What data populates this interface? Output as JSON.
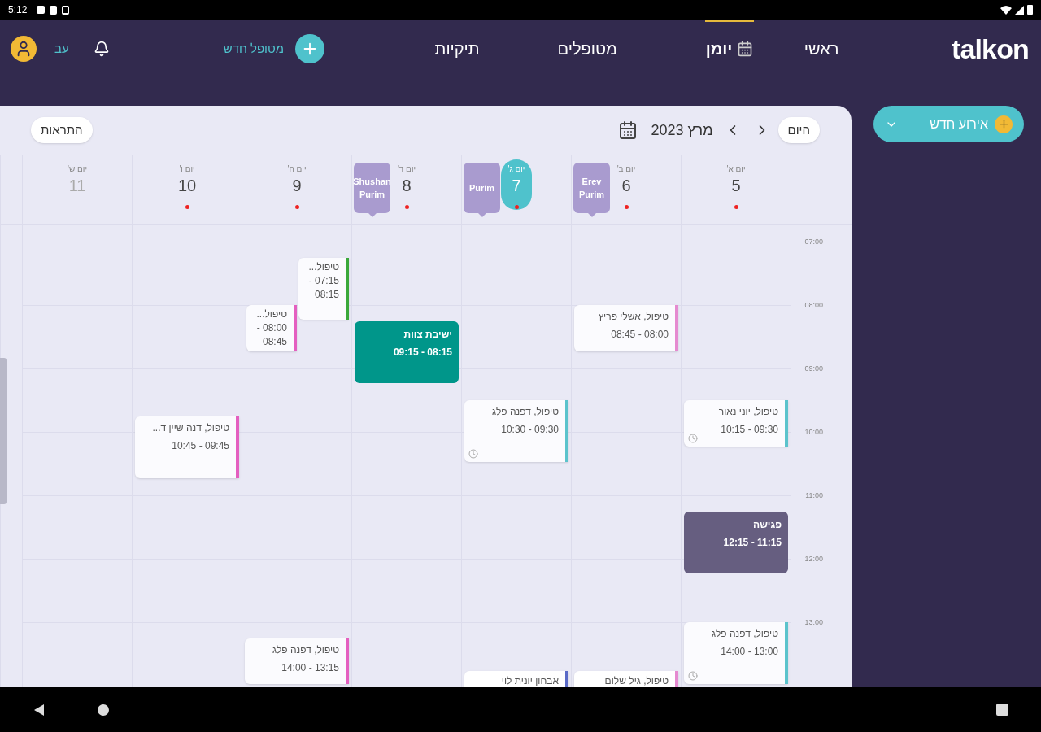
{
  "status_bar": {
    "time": "5:12"
  },
  "header": {
    "logo": "talkon",
    "user_initials": "עב",
    "new_patient": "מטופל חדש",
    "nav": [
      {
        "label": "ראשי",
        "selected": false
      },
      {
        "label": "יומן",
        "selected": true,
        "icon": true
      },
      {
        "label": "מטופלים",
        "selected": false
      },
      {
        "label": "תיקיות",
        "selected": false
      }
    ]
  },
  "new_event_button": "אירוע חדש",
  "calendar": {
    "today_button": "היום",
    "month": "מרץ 2023",
    "alerts_button": "התראות",
    "hours": [
      "07:00",
      "08:00",
      "09:00",
      "10:00",
      "11:00",
      "12:00",
      "13:00"
    ],
    "days": [
      {
        "name": "יום א'",
        "number": "5",
        "dot": true,
        "today": false,
        "muted": false,
        "events": [
          {
            "kind": "appointment",
            "title": "טיפול, יוני נאור",
            "time": "09:30 - 10:15",
            "color": "#5bc3cc",
            "clock": true
          },
          {
            "kind": "block",
            "title": "פגישה",
            "time": "11:15 - 12:15",
            "color": "#665e80"
          },
          {
            "kind": "appointment",
            "title": "טיפול, דפנה פלג",
            "time": "13:00 - 14:00",
            "color": "#5bc3cc",
            "clock": true
          }
        ]
      },
      {
        "name": "יום ב'",
        "number": "6",
        "dot": true,
        "today": false,
        "muted": false,
        "holiday": "Erev Purim",
        "events": [
          {
            "kind": "appointment",
            "title": "טיפול, אשלי פריץ",
            "time": "08:00 - 08:45",
            "color": "#e58ad0"
          },
          {
            "kind": "partial",
            "title": "טיפול, גיל שלום",
            "color": "#e58ad0"
          }
        ]
      },
      {
        "name": "יום ג'",
        "number": "7",
        "dot": true,
        "today": true,
        "muted": false,
        "holiday": "Purim",
        "events": [
          {
            "kind": "appointment",
            "title": "טיפול, דפנה פלג",
            "time": "09:30 - 10:30",
            "color": "#5bc3cc",
            "clock": true
          },
          {
            "kind": "partial",
            "title": "אבחון יונית לוי",
            "color": "#5b6bc7"
          }
        ]
      },
      {
        "name": "יום ד'",
        "number": "8",
        "dot": true,
        "today": false,
        "muted": false,
        "holiday": "Shushan Purim",
        "events": [
          {
            "kind": "block",
            "title": "ישיבת צוות",
            "time": "08:15 - 09:15",
            "color": "#00968a"
          }
        ]
      },
      {
        "name": "יום ה'",
        "number": "9",
        "dot": true,
        "today": false,
        "muted": false,
        "events": [
          {
            "kind": "appointment",
            "title": "טיפול...",
            "time": "07:15 - 08:15",
            "color": "#3aa83a"
          },
          {
            "kind": "appointment",
            "title": "טיפול...",
            "time": "08:00 - 08:45",
            "color": "#e45fc0"
          },
          {
            "kind": "appointment",
            "title": "טיפול, דפנה פלג",
            "time": "13:15 - 14:00",
            "color": "#e45fc0"
          }
        ]
      },
      {
        "name": "יום ו'",
        "number": "10",
        "dot": true,
        "today": false,
        "muted": false,
        "events": [
          {
            "kind": "appointment",
            "title": "טיפול, דנה שיין ד...",
            "time": "09:45 - 10:45",
            "color": "#e45fc0"
          }
        ]
      },
      {
        "name": "יום ש'",
        "number": "11",
        "dot": false,
        "today": false,
        "muted": true
      }
    ]
  }
}
